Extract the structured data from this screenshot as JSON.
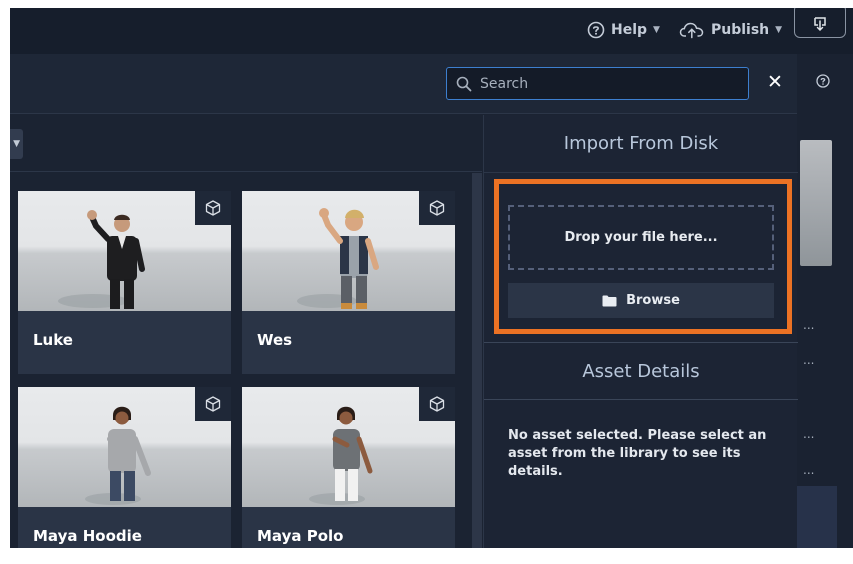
{
  "topbar": {
    "help_label": "Help",
    "publish_label": "Publish"
  },
  "search": {
    "placeholder": "Search",
    "value": ""
  },
  "assets": [
    {
      "name": "Luke"
    },
    {
      "name": "Wes"
    },
    {
      "name": "Maya Hoodie"
    },
    {
      "name": "Maya Polo"
    }
  ],
  "panel": {
    "import_title": "Import From Disk",
    "drop_text": "Drop your file here...",
    "browse_label": "Browse",
    "details_title": "Asset Details",
    "details_empty": "No asset selected. Please select an asset from the library to see its details."
  },
  "right_strip": {
    "truncation_markers": [
      "...",
      "...",
      "...",
      "..."
    ]
  },
  "colors": {
    "app_bg": "#1b2332",
    "accent_highlight": "#ec7224",
    "search_border": "#3d7fcf",
    "card_bg": "#2a3446"
  }
}
